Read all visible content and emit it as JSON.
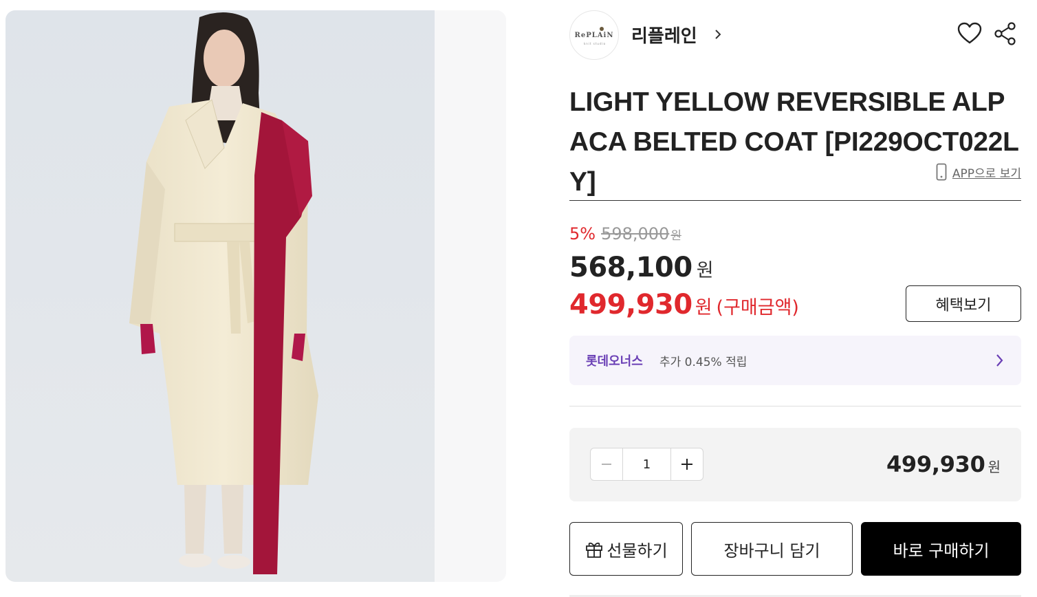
{
  "brand": {
    "logo_text": "RePLAiN",
    "logo_sub": "knit studio",
    "name": "리플레인"
  },
  "product": {
    "title": "LIGHT YELLOW REVERSIBLE ALPACA BELTED COAT [PI229OCT022LY]",
    "image_alt": "Model wearing a light yellow belted coat with a red scarf"
  },
  "app_link": "APP으로 보기",
  "pricing": {
    "discount_rate": "5%",
    "original_price": "598,000",
    "original_unit": "원",
    "sale_price": "568,100",
    "sale_unit": "원",
    "buy_price": "499,930",
    "buy_unit": "원",
    "buy_note": "(구매금액)"
  },
  "benefit_button": "혜택보기",
  "points": {
    "brand": "롯데오너스",
    "text": "추가 0.45% 적립"
  },
  "quantity": {
    "value": "1",
    "total": "499,930",
    "unit": "원"
  },
  "actions": {
    "gift": "선물하기",
    "cart": "장바구니 담기",
    "buy": "바로 구매하기"
  },
  "colors": {
    "accent_red": "#e0282d",
    "points_purple": "#6a3fb5",
    "buy_button": "#000000"
  },
  "icons": [
    "heart-icon",
    "share-icon",
    "phone-icon",
    "chevron-right-icon",
    "minus-icon",
    "plus-icon",
    "gift-icon"
  ]
}
